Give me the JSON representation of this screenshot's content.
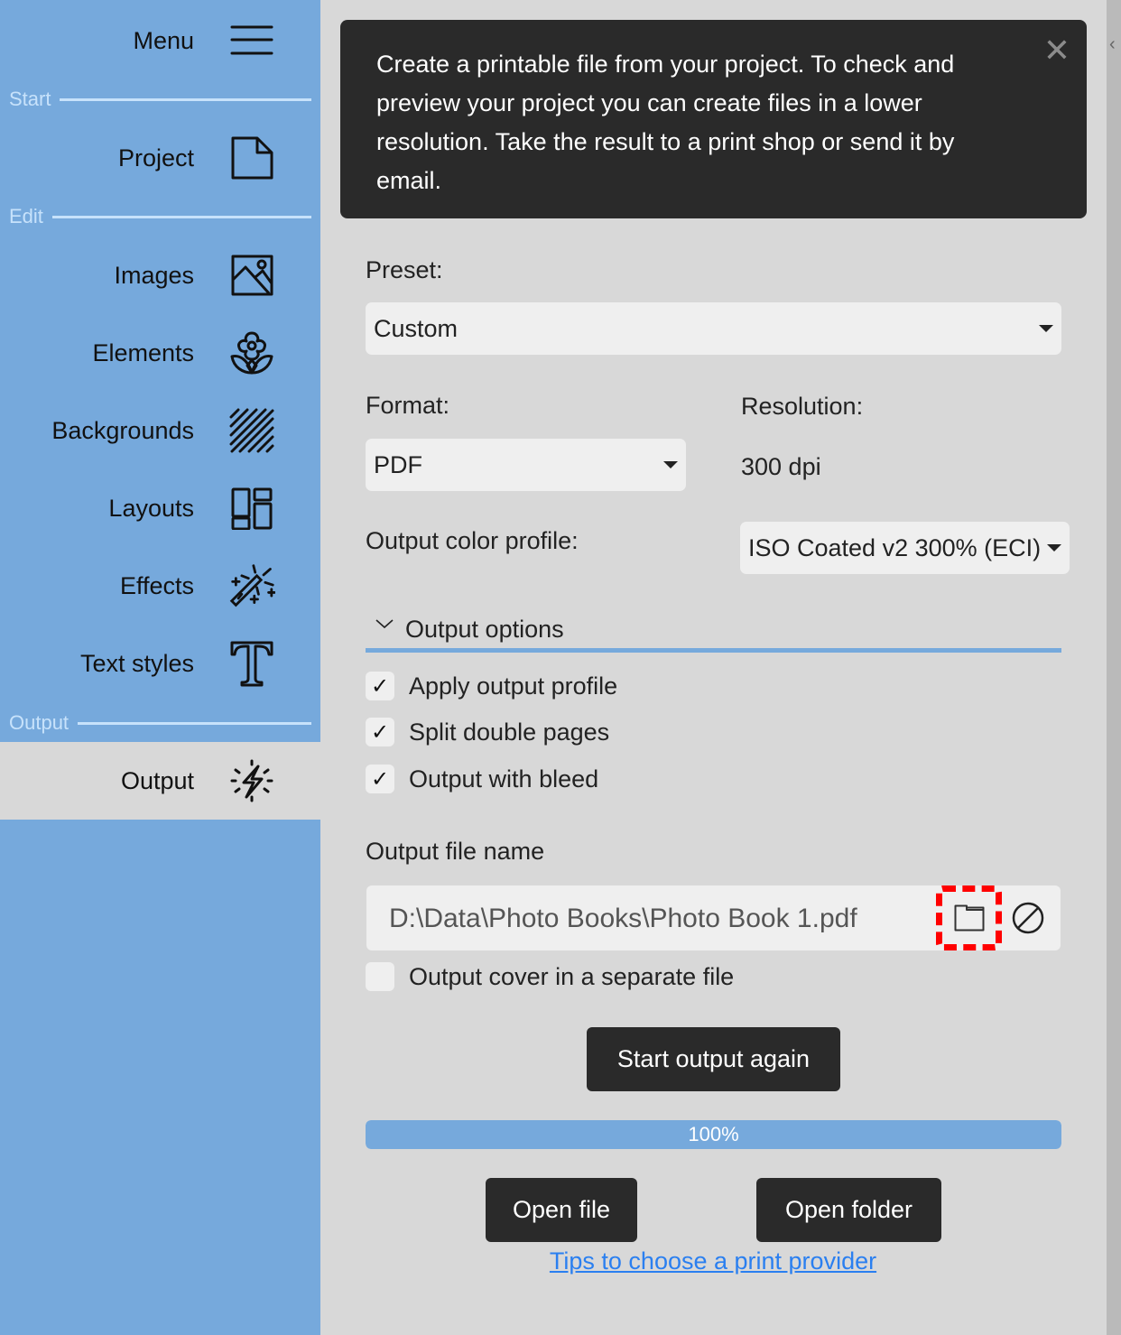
{
  "sidebar": {
    "menu_label": "Menu",
    "sections": {
      "start": "Start",
      "edit": "Edit",
      "output": "Output"
    },
    "items": [
      {
        "label": "Project",
        "icon": "document-icon"
      },
      {
        "label": "Images",
        "icon": "image-icon"
      },
      {
        "label": "Elements",
        "icon": "flower-icon"
      },
      {
        "label": "Backgrounds",
        "icon": "hatch-pattern-icon"
      },
      {
        "label": "Layouts",
        "icon": "layout-grid-icon"
      },
      {
        "label": "Effects",
        "icon": "magic-wand-icon"
      },
      {
        "label": "Text styles",
        "icon": "text-t-icon"
      },
      {
        "label": "Output",
        "icon": "spark-bolt-icon",
        "active": true
      }
    ],
    "colors": {
      "background": "#76a9dc",
      "active": "#d8d8d8"
    }
  },
  "info_box": {
    "text": "Create a printable file from your project. To check and preview your project you can create files in a lower resolution. Take the result to a print shop or send it by email.",
    "close_icon": "close-icon"
  },
  "form": {
    "preset_label": "Preset:",
    "preset_value": "Custom",
    "format_label": "Format:",
    "format_value": "PDF",
    "resolution_label": "Resolution:",
    "resolution_value": "300 dpi",
    "color_profile_label": "Output color profile:",
    "color_profile_value": "ISO Coated v2 300% (ECI)",
    "output_options_label": "Output options",
    "checkboxes": [
      {
        "label": "Apply output profile",
        "checked": true
      },
      {
        "label": "Split double pages",
        "checked": true
      },
      {
        "label": "Output with bleed",
        "checked": true
      }
    ],
    "check_mark": "✓",
    "file_name_label": "Output file name",
    "file_name_value": "D:\\Data\\Photo Books\\Photo Book 1.pdf",
    "cover_separate_label": "Output cover in a separate file",
    "cover_separate_checked": false
  },
  "actions": {
    "start_button": "Start output again",
    "progress_percent": 100,
    "progress_label": "100%",
    "open_file_button": "Open file",
    "open_folder_button": "Open folder",
    "tips_link": "Tips to choose a print provider"
  },
  "colors": {
    "accent": "#76a9dc",
    "dark": "#2a2a2a",
    "link": "#2a7ff0",
    "highlight": "#ff0000"
  }
}
